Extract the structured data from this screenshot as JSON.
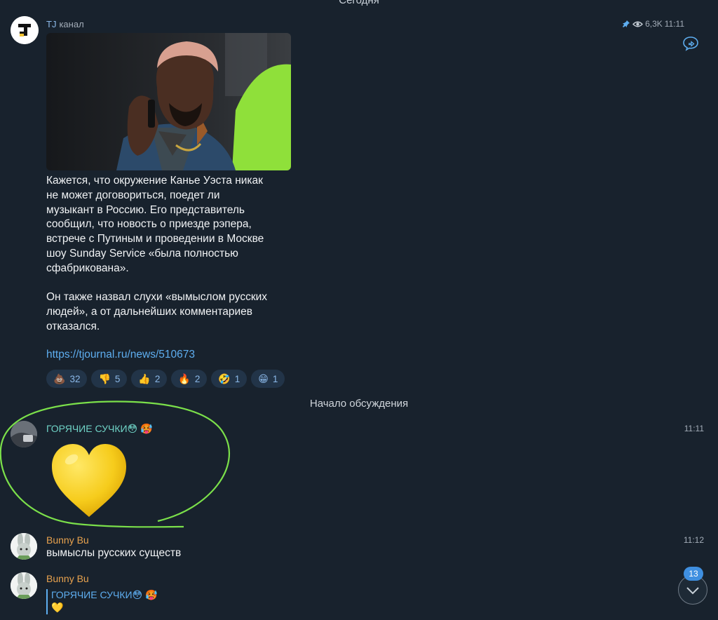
{
  "date_header": "Сегодня",
  "channel_post": {
    "channel_name": "TJ",
    "channel_sub": "канал",
    "views": "6,3K",
    "time": "11:11",
    "text": "Кажется, что окружение Канье Уэста никак\nне может договориться, поедет ли\nмузыкант в Россию. Его представитель\nсообщил, что новость о приезде рэпера,\nвстрече с Путиным и проведении в Москве\nшоу Sunday Service «была полностью\nсфабрикована».\n\nОн также назвал слухи «вымыслом русских\nлюдей», а от дальнейших комментариев\nотказался.",
    "link": "https://tjournal.ru/news/510673",
    "reactions": [
      {
        "emoji": "💩",
        "count": "32"
      },
      {
        "emoji": "👎",
        "count": "5"
      },
      {
        "emoji": "👍",
        "count": "2"
      },
      {
        "emoji": "🔥",
        "count": "2"
      },
      {
        "emoji": "🤣",
        "count": "1"
      },
      {
        "emoji": "😁",
        "count": "1"
      }
    ]
  },
  "discussion_label": "Начало обсуждения",
  "messages": [
    {
      "author": "ГОРЯЧИЕ СУЧКИ😳 🥵",
      "time": "11:11",
      "sticker": "💛"
    },
    {
      "author": "Bunny Bu",
      "time": "11:12",
      "text": "вымыслы русских существ"
    },
    {
      "author": "Bunny Bu",
      "reply_to": "ГОРЯЧИЕ СУЧКИ😳 🥵",
      "reply_preview": "💛"
    }
  ],
  "unread_badge": "13",
  "colors": {
    "background": "#18222d",
    "link": "#5eaef0",
    "author_teal": "#6fd3c6",
    "author_orange": "#e8a24e",
    "highlight_green": "#7be04a"
  }
}
